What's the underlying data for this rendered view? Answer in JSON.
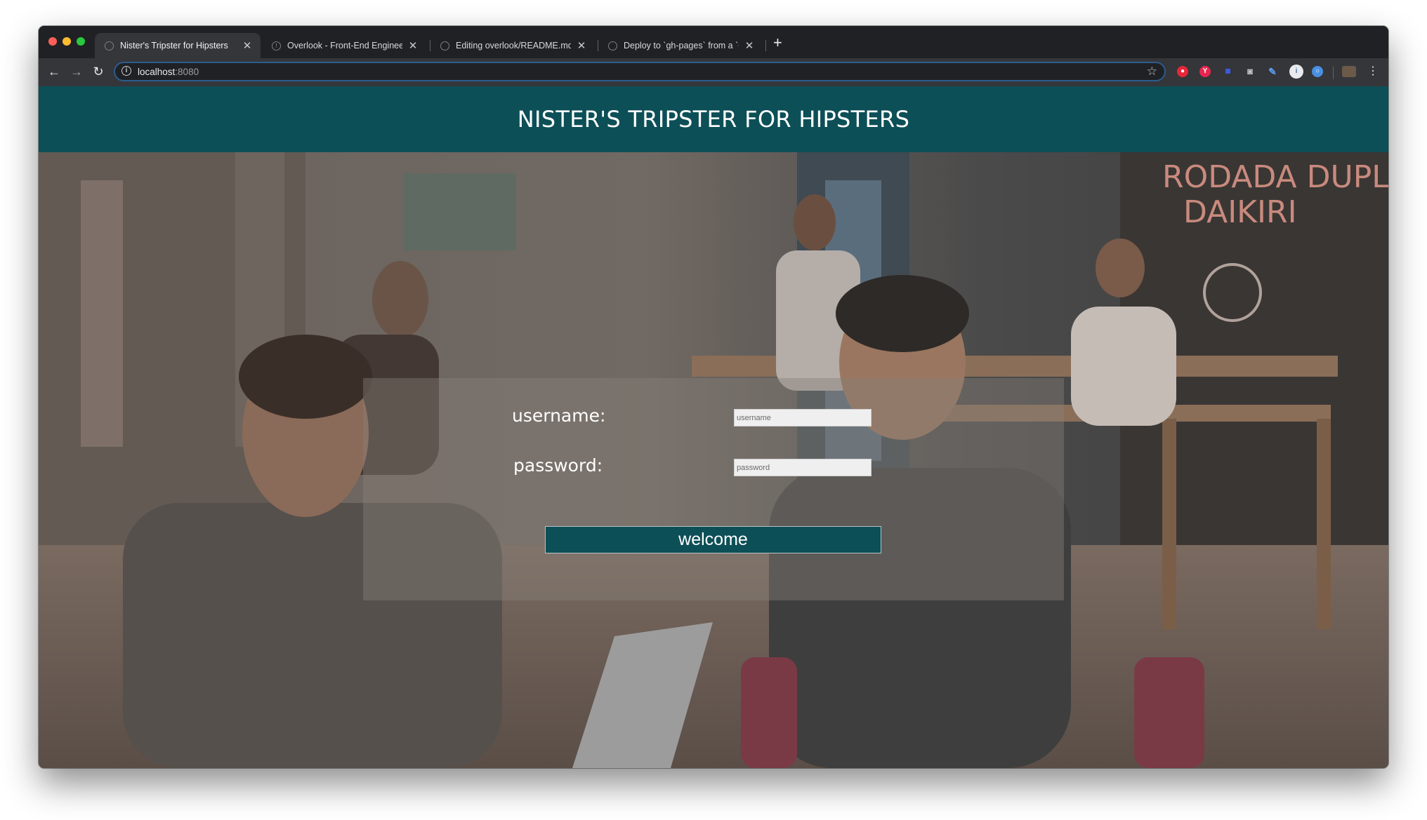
{
  "browser": {
    "tabs": [
      {
        "title": "Nister's Tripster for Hipsters",
        "active": true
      },
      {
        "title": "Overlook - Front-End Engineerin",
        "active": false
      },
      {
        "title": "Editing overlook/README.md at",
        "active": false
      },
      {
        "title": "Deploy to `gh-pages` from a `d",
        "active": false
      }
    ],
    "close_glyph": "✕",
    "new_tab_glyph": "+",
    "address": {
      "host": "localhost",
      "port": ":8080"
    },
    "icons": [
      "back-arrow-icon",
      "forward-arrow-icon",
      "reload-icon",
      "info-icon",
      "bookmark-star-icon",
      "menu-kebab-icon"
    ],
    "extensions": [
      {
        "name": "red-shield-extension-icon",
        "color": "#e8263a"
      },
      {
        "name": "pink-badge-extension-icon",
        "color": "#e8264f"
      },
      {
        "name": "blue-square-extension-icon",
        "color": "#3b5bdb"
      },
      {
        "name": "camera-extension-icon",
        "color": "#9aa0a6"
      },
      {
        "name": "eyedropper-extension-icon",
        "color": "#5b9cf0"
      },
      {
        "name": "white-circle-extension-icon",
        "color": "#e8eaed"
      },
      {
        "name": "blue-ring-extension-icon",
        "color": "#4a90e2"
      },
      {
        "name": "profile-avatar-icon",
        "color": "#6b5a4a"
      }
    ]
  },
  "page": {
    "header_title": "NISTER'S TRIPSTER FOR HIPSTERS",
    "header_color": "#0d4f57",
    "form": {
      "username_label": "username:",
      "username_placeholder": "username",
      "password_label": "password:",
      "password_placeholder": "password",
      "submit_label": "welcome"
    }
  }
}
